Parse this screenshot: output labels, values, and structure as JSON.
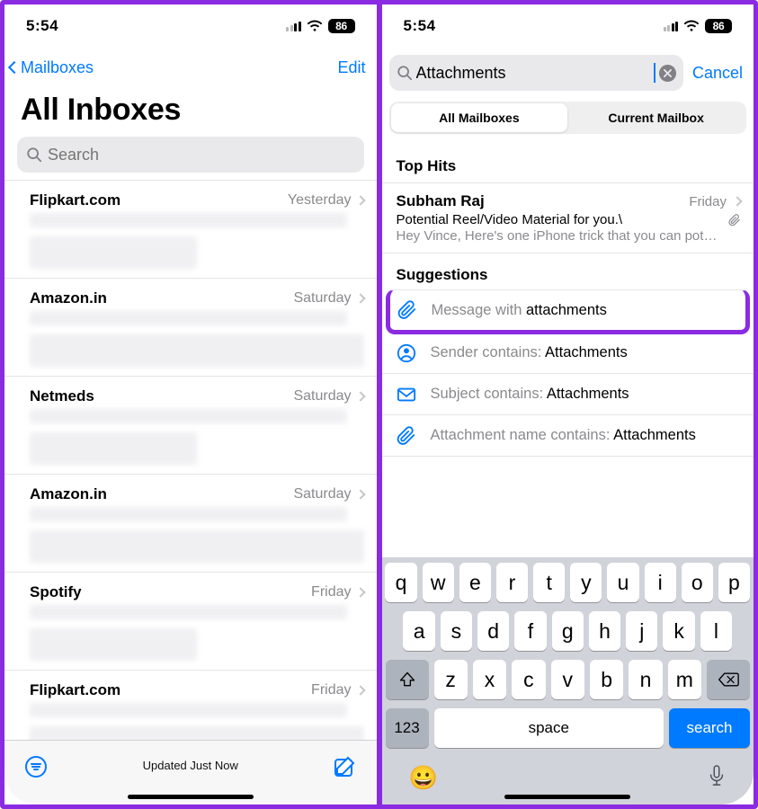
{
  "status": {
    "time": "5:54",
    "battery": "86"
  },
  "left": {
    "nav_back": "Mailboxes",
    "nav_edit": "Edit",
    "title": "All Inboxes",
    "search_placeholder": "Search",
    "toolbar_status": "Updated Just Now",
    "messages": [
      {
        "sender": "Flipkart.com",
        "date": "Yesterday"
      },
      {
        "sender": "Amazon.in",
        "date": "Saturday"
      },
      {
        "sender": "Netmeds",
        "date": "Saturday"
      },
      {
        "sender": "Amazon.in",
        "date": "Saturday"
      },
      {
        "sender": "Spotify",
        "date": "Friday"
      },
      {
        "sender": "Flipkart.com",
        "date": "Friday"
      }
    ]
  },
  "right": {
    "search_value": "Attachments",
    "cancel": "Cancel",
    "seg": {
      "a": "All Mailboxes",
      "b": "Current Mailbox"
    },
    "sections": {
      "tophits": "Top Hits",
      "suggestions": "Suggestions"
    },
    "tophit": {
      "sender": "Subham Raj",
      "date": "Friday",
      "subject": "Potential Reel/Video Material for you.\\",
      "preview": "Hey Vince, Here's one iPhone trick that you can pot…"
    },
    "suggestions": [
      {
        "icon": "paperclip",
        "lead": "Message with ",
        "emph": "attachments"
      },
      {
        "icon": "person",
        "lead": "Sender contains: ",
        "emph": "Attachments"
      },
      {
        "icon": "envelope",
        "lead": "Subject contains: ",
        "emph": "Attachments"
      },
      {
        "icon": "paperclip",
        "lead": "Attachment name contains: ",
        "emph": "Attachments"
      }
    ],
    "keyboard": {
      "row1": [
        "q",
        "w",
        "e",
        "r",
        "t",
        "y",
        "u",
        "i",
        "o",
        "p"
      ],
      "row2": [
        "a",
        "s",
        "d",
        "f",
        "g",
        "h",
        "j",
        "k",
        "l"
      ],
      "row3": [
        "z",
        "x",
        "c",
        "v",
        "b",
        "n",
        "m"
      ],
      "fn": "123",
      "space": "space",
      "search": "search"
    }
  }
}
